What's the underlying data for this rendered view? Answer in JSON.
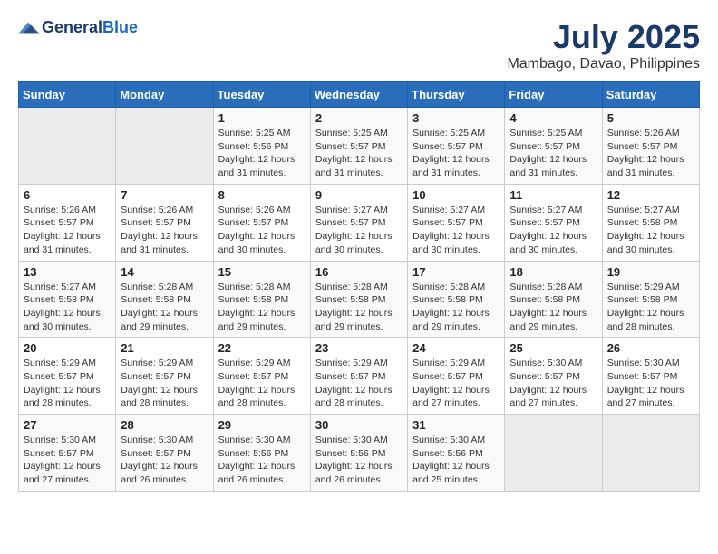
{
  "header": {
    "logo_line1": "General",
    "logo_line2": "Blue",
    "main_title": "July 2025",
    "subtitle": "Mambago, Davao, Philippines"
  },
  "days_of_week": [
    "Sunday",
    "Monday",
    "Tuesday",
    "Wednesday",
    "Thursday",
    "Friday",
    "Saturday"
  ],
  "weeks": [
    [
      {
        "day": "",
        "info": ""
      },
      {
        "day": "",
        "info": ""
      },
      {
        "day": "1",
        "info": "Sunrise: 5:25 AM\nSunset: 5:56 PM\nDaylight: 12 hours and 31 minutes."
      },
      {
        "day": "2",
        "info": "Sunrise: 5:25 AM\nSunset: 5:57 PM\nDaylight: 12 hours and 31 minutes."
      },
      {
        "day": "3",
        "info": "Sunrise: 5:25 AM\nSunset: 5:57 PM\nDaylight: 12 hours and 31 minutes."
      },
      {
        "day": "4",
        "info": "Sunrise: 5:25 AM\nSunset: 5:57 PM\nDaylight: 12 hours and 31 minutes."
      },
      {
        "day": "5",
        "info": "Sunrise: 5:26 AM\nSunset: 5:57 PM\nDaylight: 12 hours and 31 minutes."
      }
    ],
    [
      {
        "day": "6",
        "info": "Sunrise: 5:26 AM\nSunset: 5:57 PM\nDaylight: 12 hours and 31 minutes."
      },
      {
        "day": "7",
        "info": "Sunrise: 5:26 AM\nSunset: 5:57 PM\nDaylight: 12 hours and 31 minutes."
      },
      {
        "day": "8",
        "info": "Sunrise: 5:26 AM\nSunset: 5:57 PM\nDaylight: 12 hours and 30 minutes."
      },
      {
        "day": "9",
        "info": "Sunrise: 5:27 AM\nSunset: 5:57 PM\nDaylight: 12 hours and 30 minutes."
      },
      {
        "day": "10",
        "info": "Sunrise: 5:27 AM\nSunset: 5:57 PM\nDaylight: 12 hours and 30 minutes."
      },
      {
        "day": "11",
        "info": "Sunrise: 5:27 AM\nSunset: 5:57 PM\nDaylight: 12 hours and 30 minutes."
      },
      {
        "day": "12",
        "info": "Sunrise: 5:27 AM\nSunset: 5:58 PM\nDaylight: 12 hours and 30 minutes."
      }
    ],
    [
      {
        "day": "13",
        "info": "Sunrise: 5:27 AM\nSunset: 5:58 PM\nDaylight: 12 hours and 30 minutes."
      },
      {
        "day": "14",
        "info": "Sunrise: 5:28 AM\nSunset: 5:58 PM\nDaylight: 12 hours and 29 minutes."
      },
      {
        "day": "15",
        "info": "Sunrise: 5:28 AM\nSunset: 5:58 PM\nDaylight: 12 hours and 29 minutes."
      },
      {
        "day": "16",
        "info": "Sunrise: 5:28 AM\nSunset: 5:58 PM\nDaylight: 12 hours and 29 minutes."
      },
      {
        "day": "17",
        "info": "Sunrise: 5:28 AM\nSunset: 5:58 PM\nDaylight: 12 hours and 29 minutes."
      },
      {
        "day": "18",
        "info": "Sunrise: 5:28 AM\nSunset: 5:58 PM\nDaylight: 12 hours and 29 minutes."
      },
      {
        "day": "19",
        "info": "Sunrise: 5:29 AM\nSunset: 5:58 PM\nDaylight: 12 hours and 28 minutes."
      }
    ],
    [
      {
        "day": "20",
        "info": "Sunrise: 5:29 AM\nSunset: 5:57 PM\nDaylight: 12 hours and 28 minutes."
      },
      {
        "day": "21",
        "info": "Sunrise: 5:29 AM\nSunset: 5:57 PM\nDaylight: 12 hours and 28 minutes."
      },
      {
        "day": "22",
        "info": "Sunrise: 5:29 AM\nSunset: 5:57 PM\nDaylight: 12 hours and 28 minutes."
      },
      {
        "day": "23",
        "info": "Sunrise: 5:29 AM\nSunset: 5:57 PM\nDaylight: 12 hours and 28 minutes."
      },
      {
        "day": "24",
        "info": "Sunrise: 5:29 AM\nSunset: 5:57 PM\nDaylight: 12 hours and 27 minutes."
      },
      {
        "day": "25",
        "info": "Sunrise: 5:30 AM\nSunset: 5:57 PM\nDaylight: 12 hours and 27 minutes."
      },
      {
        "day": "26",
        "info": "Sunrise: 5:30 AM\nSunset: 5:57 PM\nDaylight: 12 hours and 27 minutes."
      }
    ],
    [
      {
        "day": "27",
        "info": "Sunrise: 5:30 AM\nSunset: 5:57 PM\nDaylight: 12 hours and 27 minutes."
      },
      {
        "day": "28",
        "info": "Sunrise: 5:30 AM\nSunset: 5:57 PM\nDaylight: 12 hours and 26 minutes."
      },
      {
        "day": "29",
        "info": "Sunrise: 5:30 AM\nSunset: 5:56 PM\nDaylight: 12 hours and 26 minutes."
      },
      {
        "day": "30",
        "info": "Sunrise: 5:30 AM\nSunset: 5:56 PM\nDaylight: 12 hours and 26 minutes."
      },
      {
        "day": "31",
        "info": "Sunrise: 5:30 AM\nSunset: 5:56 PM\nDaylight: 12 hours and 25 minutes."
      },
      {
        "day": "",
        "info": ""
      },
      {
        "day": "",
        "info": ""
      }
    ]
  ]
}
